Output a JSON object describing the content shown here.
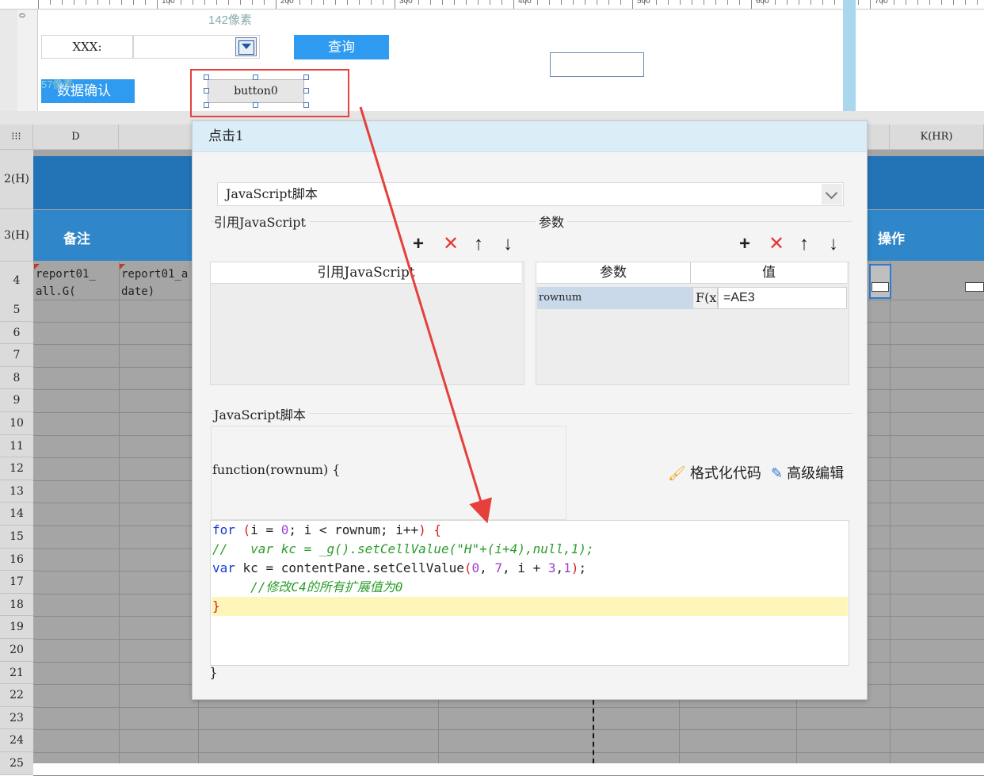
{
  "ruler": {
    "numbers": [
      "100",
      "200",
      "300",
      "400",
      "500",
      "600",
      "700"
    ],
    "left_number": "0"
  },
  "designer": {
    "size_label": "142像素",
    "field_label": "XXX:",
    "query_button": "查询",
    "confirm_button": "数据确认",
    "confirm_ghost": "57像素",
    "selected_button": "button0"
  },
  "sheet": {
    "columns": [
      "D",
      "K(HR)"
    ],
    "rows": [
      "2(H)",
      "3(H)",
      "4",
      "5",
      "6",
      "7",
      "8",
      "9",
      "10",
      "11",
      "12",
      "13",
      "14",
      "15",
      "16",
      "17",
      "18",
      "19",
      "20",
      "21",
      "22",
      "23",
      "24",
      "25"
    ],
    "header_cells": {
      "remark": "备注",
      "operation": "操作"
    },
    "row4": {
      "d_text_line1": "report01_",
      "d_text_line2": "all.G(",
      "e_text_line1": "report01_a",
      "e_text_line2": "date)"
    }
  },
  "dialog": {
    "title": "点击1",
    "type_select_value": "JavaScript脚本",
    "ref_js_section": "引用JavaScript",
    "params_section": "参数",
    "toolbar_icons": {
      "add": "+",
      "delete": "✕",
      "up": "↑",
      "down": "↓"
    },
    "ref_js_table_header": "引用JavaScript",
    "params_table_header": {
      "name": "参数",
      "value": "值"
    },
    "params_rows": [
      {
        "name": "rownum",
        "fx": "F(x)",
        "value": "=AE3"
      }
    ],
    "script_section": "JavaScript脚本",
    "fn_header": "function(rownum) {",
    "fn_footer": "}",
    "format_code_button": "格式化代码",
    "advanced_edit_button": "高级编辑",
    "code_lines": [
      "for (i = 0; i < rownum; i++) {",
      "//   var kc = _g().setCellValue(\"H\"+(i+4),null,1);",
      "var kc = contentPane.setCellValue(0, 7, i + 3,1);",
      "     //修改C4的所有扩展值为0",
      "}"
    ]
  },
  "colors": {
    "accent_blue": "#2e9bf0",
    "header_blue": "#2373b7",
    "highlight_red": "#e5403b",
    "dialog_title_bg": "#dbeef8"
  }
}
